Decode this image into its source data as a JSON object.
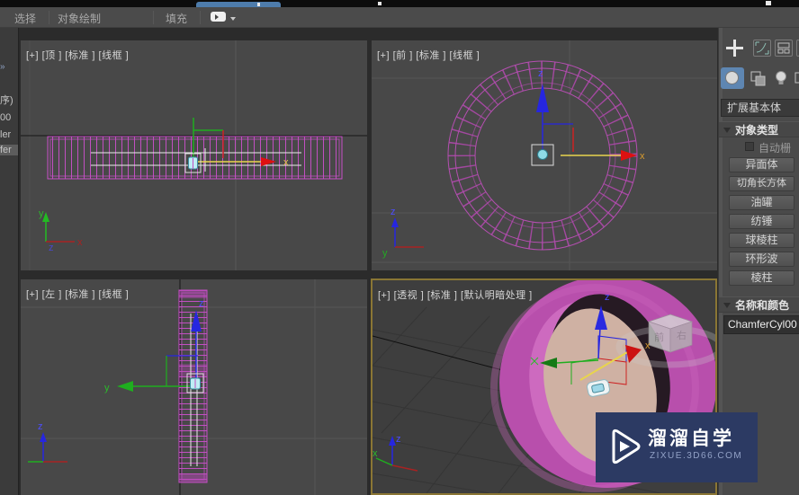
{
  "topbar": {
    "items": [
      "选择",
      "对象绘制",
      "填充"
    ]
  },
  "left_dock": {
    "chevron": "»",
    "fragments": [
      "序)",
      "00",
      "ler",
      "fer"
    ]
  },
  "viewports": {
    "top_label": "[+] [顶 ] [标准 ] [线框 ]",
    "front_label": "[+] [前 ] [标准 ] [线框 ]",
    "left_label": "[+] [左 ] [标准 ] [线框 ]",
    "persp_label": "[+] [透视 ] [标准 ] [默认明暗处理 ]"
  },
  "axes": {
    "x": "x",
    "y": "y",
    "z": "z"
  },
  "viewcube": {
    "front": "前",
    "right": "右"
  },
  "panel": {
    "category": "扩展基本体",
    "object_type_title": "对象类型",
    "autogrid": "自动栅",
    "buttons": [
      "异面体",
      "切角长方体",
      "油罐",
      "纺锤",
      "球棱柱",
      "环形波",
      "棱柱"
    ],
    "name_color_title": "名称和颜色",
    "name_value": "ChamferCyl00"
  },
  "watermark": {
    "title": "溜溜自学",
    "url": "zixue.3d66.com"
  },
  "colors": {
    "wireframe_magenta": "#c94fc9",
    "object_pink": "#b84fac",
    "face_beige": "#cfb1a3",
    "gizmo_selected_yellow": "#e8d44d",
    "active_viewport_border": "#8a7634",
    "watermark_bg": "#2c3a63"
  }
}
